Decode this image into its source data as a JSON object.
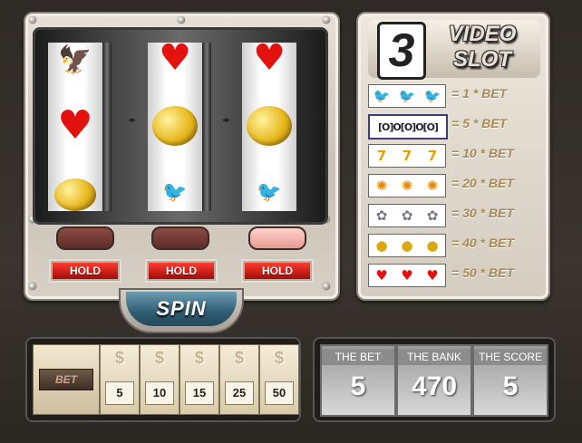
{
  "title": {
    "number": "3",
    "line1": "VIDEO",
    "line2": "SLOT"
  },
  "reels": [
    {
      "symbols": [
        "bird-icon",
        "heart-icon",
        "lemon-icon"
      ]
    },
    {
      "symbols": [
        "heart-icon",
        "lemon-icon",
        "bird-icon"
      ]
    },
    {
      "symbols": [
        "heart-icon",
        "lemon-icon",
        "bird-icon"
      ]
    }
  ],
  "hold_lamps": [
    {
      "on": false
    },
    {
      "on": false
    },
    {
      "on": true
    }
  ],
  "hold_buttons": [
    "HOLD",
    "HOLD",
    "HOLD"
  ],
  "spin_label": "SPIN",
  "paytable": [
    {
      "symbol": "bird-icon",
      "glyph": "🐦",
      "multiplier": "= 1 * BET"
    },
    {
      "symbol": "bar-icon",
      "glyph": "▭",
      "multiplier": "= 5 * BET"
    },
    {
      "symbol": "seven-icon",
      "glyph": "7",
      "multiplier": "= 10 * BET"
    },
    {
      "symbol": "sun-icon",
      "glyph": "✺",
      "multiplier": "= 20 * BET"
    },
    {
      "symbol": "bird-flower-icon",
      "glyph": "✿",
      "multiplier": "= 30 * BET"
    },
    {
      "symbol": "lemon-icon",
      "glyph": "●",
      "multiplier": "= 40 * BET"
    },
    {
      "symbol": "heart-icon",
      "glyph": "♥",
      "multiplier": "= 50 * BET"
    }
  ],
  "bet_label": "BET",
  "bet_options": [
    "5",
    "10",
    "15",
    "25",
    "50"
  ],
  "chip_symbol": "$",
  "info": [
    {
      "label": "THE BET",
      "value": "5"
    },
    {
      "label": "THE BANK",
      "value": "470"
    },
    {
      "label": "THE SCORE",
      "value": "5"
    }
  ],
  "colors": {
    "hold_red": "#e3120e",
    "spin_blue": "#2e5d73",
    "pay_text": "#a88a58"
  }
}
